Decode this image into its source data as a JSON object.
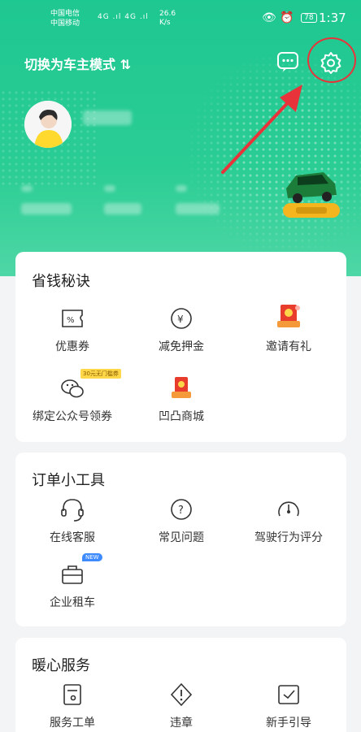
{
  "status_bar": {
    "carrier1": "中国电信",
    "carrier2": "中国移动",
    "signal": "4G .ıl 4G .ıl",
    "speed": "26.6",
    "speed_unit": "K/s",
    "battery": "78",
    "time": "1:37"
  },
  "header": {
    "mode_label": "切换为车主模式 ⇅"
  },
  "sections": {
    "savings": {
      "title": "省钱秘诀",
      "items": [
        {
          "label": "优惠券",
          "icon": "coupon-icon"
        },
        {
          "label": "减免押金",
          "icon": "yen-icon"
        },
        {
          "label": "邀请有礼",
          "icon": "gift-envelope-icon"
        },
        {
          "label": "绑定公众号领券",
          "icon": "wechat-icon",
          "tag": "30元无门槛券"
        },
        {
          "label": "凹凸商城",
          "icon": "mall-icon"
        }
      ]
    },
    "tools": {
      "title": "订单小工具",
      "items": [
        {
          "label": "在线客服",
          "icon": "headset-icon"
        },
        {
          "label": "常见问题",
          "icon": "question-icon"
        },
        {
          "label": "驾驶行为评分",
          "icon": "gauge-icon"
        },
        {
          "label": "企业租车",
          "icon": "briefcase-icon",
          "tag": "NEW"
        }
      ]
    },
    "care": {
      "title": "暖心服务",
      "items": [
        {
          "label": "服务工单",
          "icon": "ticket-icon"
        },
        {
          "label": "违章",
          "icon": "violation-icon"
        },
        {
          "label": "新手引导",
          "icon": "guide-icon"
        }
      ]
    }
  },
  "colors": {
    "brand_green": "#1fc791",
    "annotation_red": "#e8333a"
  }
}
